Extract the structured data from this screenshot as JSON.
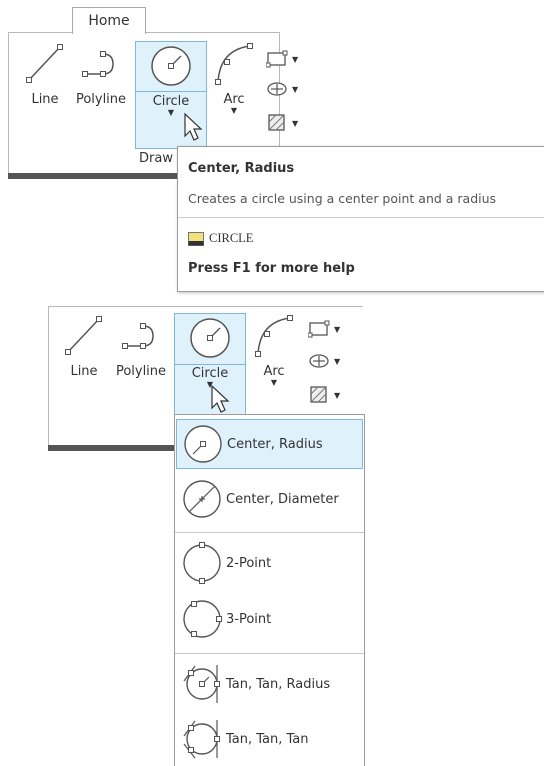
{
  "ribbon": {
    "tab_home": "Home",
    "tools": {
      "line": "Line",
      "polyline": "Polyline",
      "circle": "Circle",
      "arc": "Arc"
    },
    "panel_title": "Draw"
  },
  "tooltip": {
    "title": "Center, Radius",
    "description": "Creates a circle using a center point and a radius",
    "command": "CIRCLE",
    "help": "Press F1 for more help"
  },
  "ribbon2": {
    "tools": {
      "line": "Line",
      "polyline": "Polyline",
      "circle": "Circle",
      "arc": "Arc"
    }
  },
  "circle_menu": {
    "items": [
      {
        "label": "Center, Radius",
        "icon": "circle-center-radius-icon",
        "active": true
      },
      {
        "label": "Center, Diameter",
        "icon": "circle-center-diameter-icon"
      },
      {
        "label": "2-Point",
        "icon": "circle-2-point-icon"
      },
      {
        "label": "3-Point",
        "icon": "circle-3-point-icon"
      },
      {
        "label": "Tan, Tan, Radius",
        "icon": "circle-tan-tan-radius-icon"
      },
      {
        "label": "Tan, Tan, Tan",
        "icon": "circle-tan-tan-tan-icon"
      }
    ]
  },
  "colors": {
    "highlight": "#dff1fb",
    "highlight_border": "#7fb6dd",
    "shadow_bar": "#555555"
  }
}
